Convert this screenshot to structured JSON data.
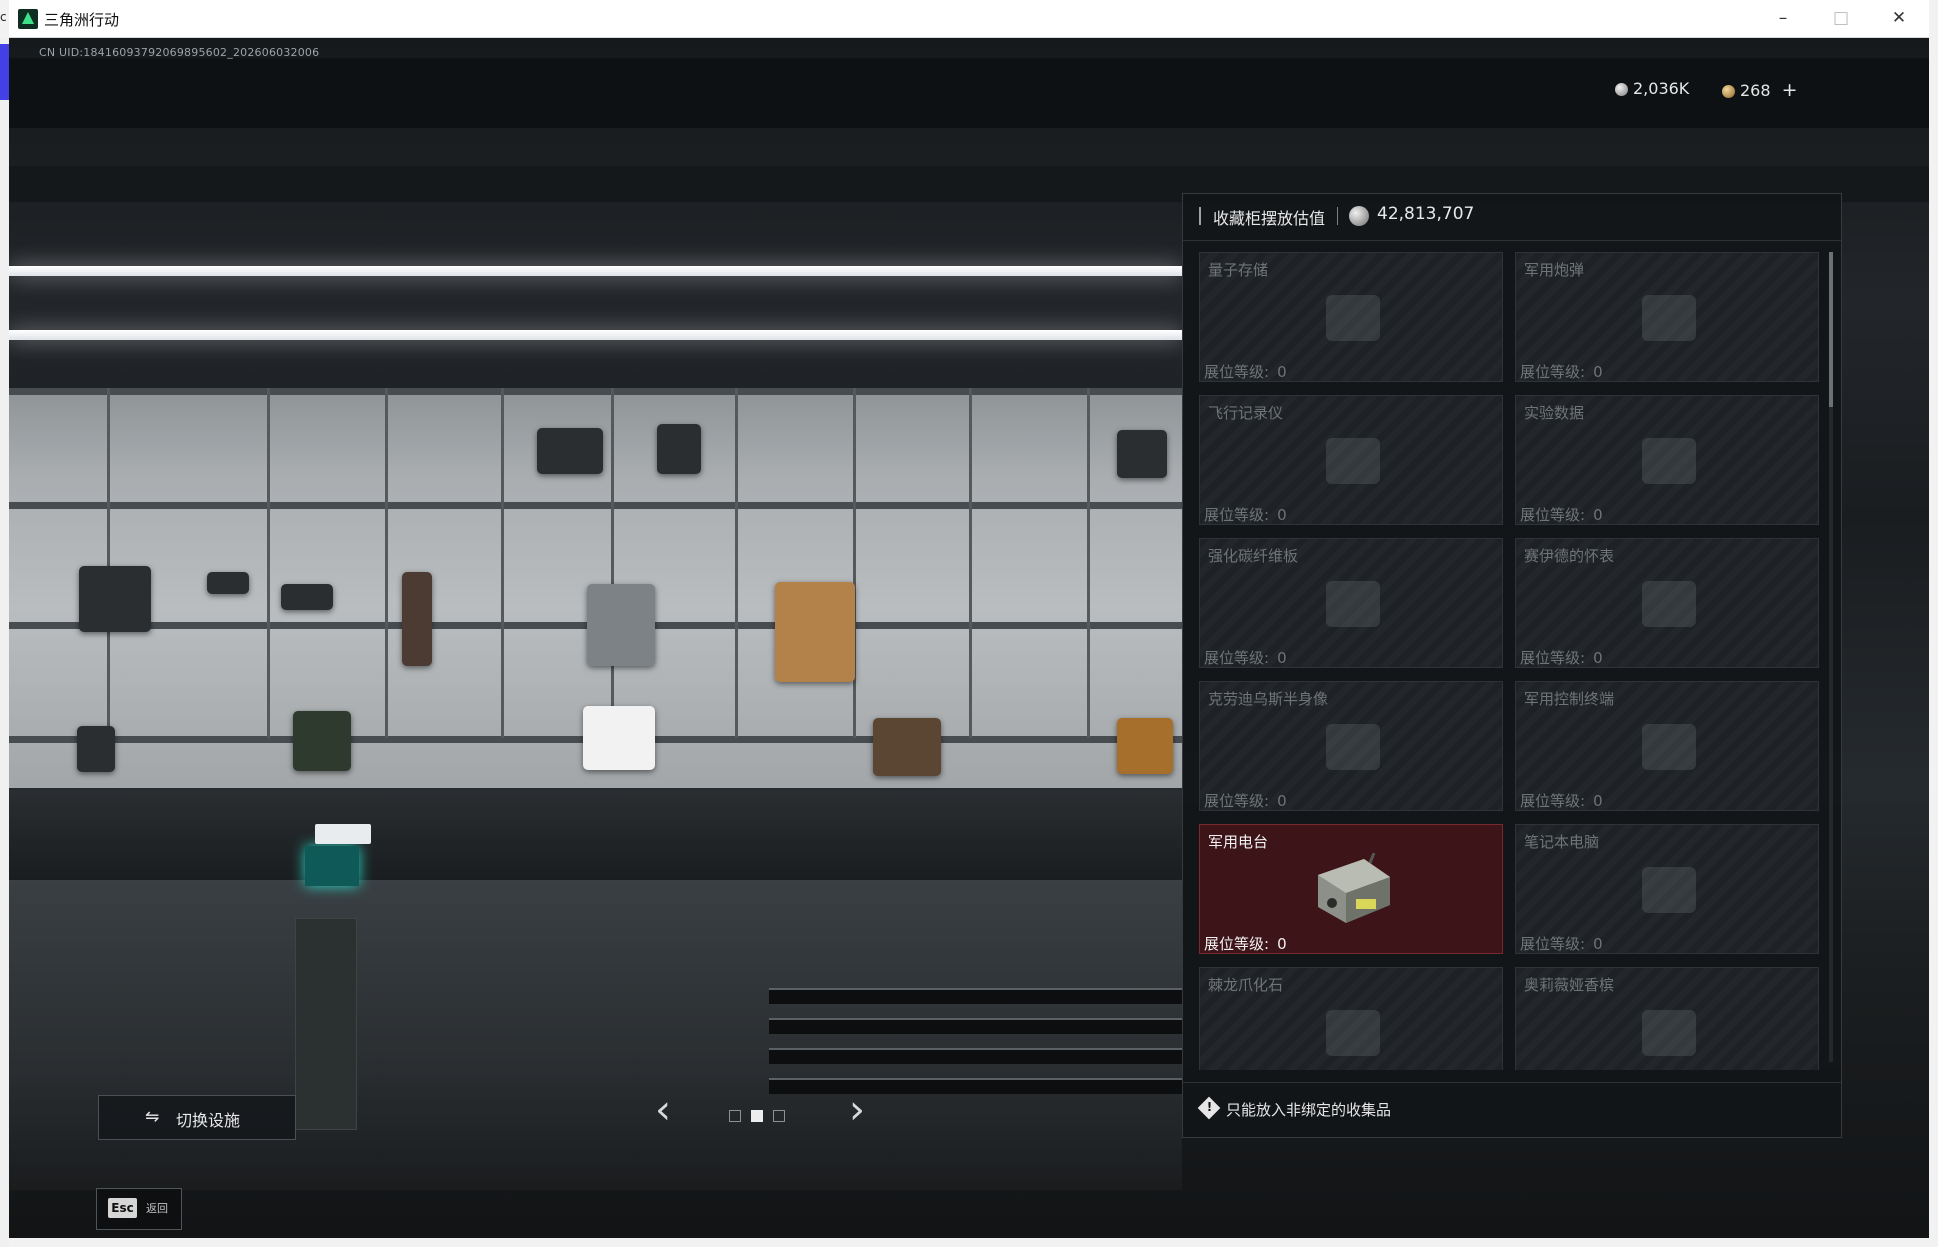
{
  "window": {
    "title": "三角洲行动",
    "minimize": "–",
    "maximize": "□",
    "close": "✕",
    "edge_fragment": "c"
  },
  "hud": {
    "uid": "CN UID:18416093792069895602_202606032006",
    "currency": [
      {
        "icon": "silver-coin-icon",
        "value": "2,036K"
      },
      {
        "icon": "gold-coin-icon",
        "value": "268",
        "add": "+"
      }
    ]
  },
  "panel": {
    "title": "收藏柜摆放估值",
    "value": "42,813,707",
    "level_label": "展位等级:",
    "slots": [
      {
        "name": "量子存储",
        "level": "0",
        "selected": false,
        "icon": "data-card-icon"
      },
      {
        "name": "军用炮弹",
        "level": "0",
        "selected": false,
        "icon": "shell-icon"
      },
      {
        "name": "飞行记录仪",
        "level": "0",
        "selected": false,
        "icon": "flight-recorder-icon"
      },
      {
        "name": "实验数据",
        "level": "0",
        "selected": false,
        "icon": "disc-icon"
      },
      {
        "name": "强化碳纤维板",
        "level": "0",
        "selected": false,
        "icon": "plate-icon"
      },
      {
        "name": "赛伊德的怀表",
        "level": "0",
        "selected": false,
        "icon": "pocket-watch-icon"
      },
      {
        "name": "克劳迪乌斯半身像",
        "level": "0",
        "selected": false,
        "icon": "bust-icon"
      },
      {
        "name": "军用控制终端",
        "level": "0",
        "selected": false,
        "icon": "terminal-icon"
      },
      {
        "name": "军用电台",
        "level": "0",
        "selected": true,
        "icon": "military-radio-icon"
      },
      {
        "name": "笔记本电脑",
        "level": "0",
        "selected": false,
        "icon": "laptop-icon"
      },
      {
        "name": "棘龙爪化石",
        "level": "0",
        "selected": false,
        "icon": "fossil-icon"
      },
      {
        "name": "奥莉薇娅香槟",
        "level": "0",
        "selected": false,
        "icon": "champagne-icon"
      }
    ],
    "footer_icon": "!",
    "footer": "只能放入非绑定的收集品"
  },
  "controls": {
    "switch_icon": "⇋",
    "switch_facility": "切换设施",
    "prev": "‹",
    "next": "›",
    "page_count": 3,
    "active_page": 1,
    "esc_key": "Esc",
    "esc_label": "返回"
  },
  "colors": {
    "selected_slot": "#3d1417",
    "panel_bg": "#121518",
    "text": "#e8e8e8",
    "dim_text": "#6f7478"
  }
}
